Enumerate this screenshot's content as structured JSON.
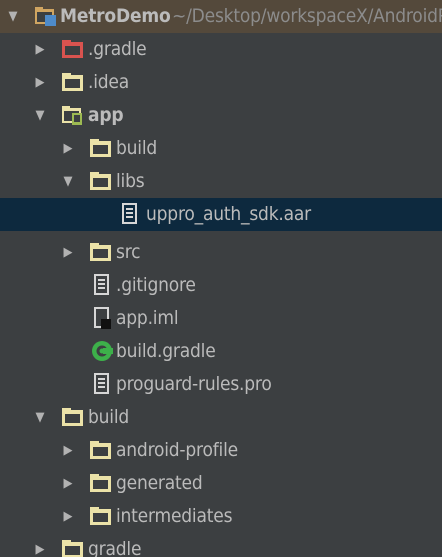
{
  "project_view": {
    "rows": [
      {
        "label": "MetroDemo",
        "path": "~/Desktop/workspaceX/AndroidP",
        "icon": "project-module-icon",
        "state": "expanded"
      },
      {
        "label": ".gradle",
        "icon": "folder-excluded-icon",
        "state": "collapsed"
      },
      {
        "label": ".idea",
        "icon": "folder-icon",
        "state": "collapsed"
      },
      {
        "label": "app",
        "icon": "android-module-icon",
        "state": "expanded"
      },
      {
        "label": "build",
        "icon": "folder-icon",
        "state": "collapsed"
      },
      {
        "label": "libs",
        "icon": "folder-icon",
        "state": "expanded"
      },
      {
        "label": "uppro_auth_sdk.aar",
        "icon": "archive-file-icon",
        "state": "leaf",
        "selected": true
      },
      {
        "label": "src",
        "icon": "folder-icon",
        "state": "collapsed"
      },
      {
        "label": ".gitignore",
        "icon": "text-file-icon",
        "state": "leaf"
      },
      {
        "label": "app.iml",
        "icon": "iml-file-icon",
        "state": "leaf"
      },
      {
        "label": "build.gradle",
        "icon": "gradle-icon",
        "state": "leaf"
      },
      {
        "label": "proguard-rules.pro",
        "icon": "text-file-icon",
        "state": "leaf"
      },
      {
        "label": "build",
        "icon": "folder-icon",
        "state": "expanded"
      },
      {
        "label": "android-profile",
        "icon": "folder-icon",
        "state": "collapsed"
      },
      {
        "label": "generated",
        "icon": "folder-icon",
        "state": "collapsed"
      },
      {
        "label": "intermediates",
        "icon": "folder-icon",
        "state": "collapsed"
      },
      {
        "label": "gradle",
        "icon": "folder-icon",
        "state": "collapsed"
      }
    ]
  },
  "colors": {
    "background": "#3c3f41",
    "project_row_highlight": "#54493b",
    "selection": "#0d293e",
    "folder": "#ebe2a8",
    "excluded_folder": "#d9534f",
    "text": "#bbbbbb",
    "muted_text": "#8c8c8c",
    "gradle_green": "#3db04a"
  }
}
